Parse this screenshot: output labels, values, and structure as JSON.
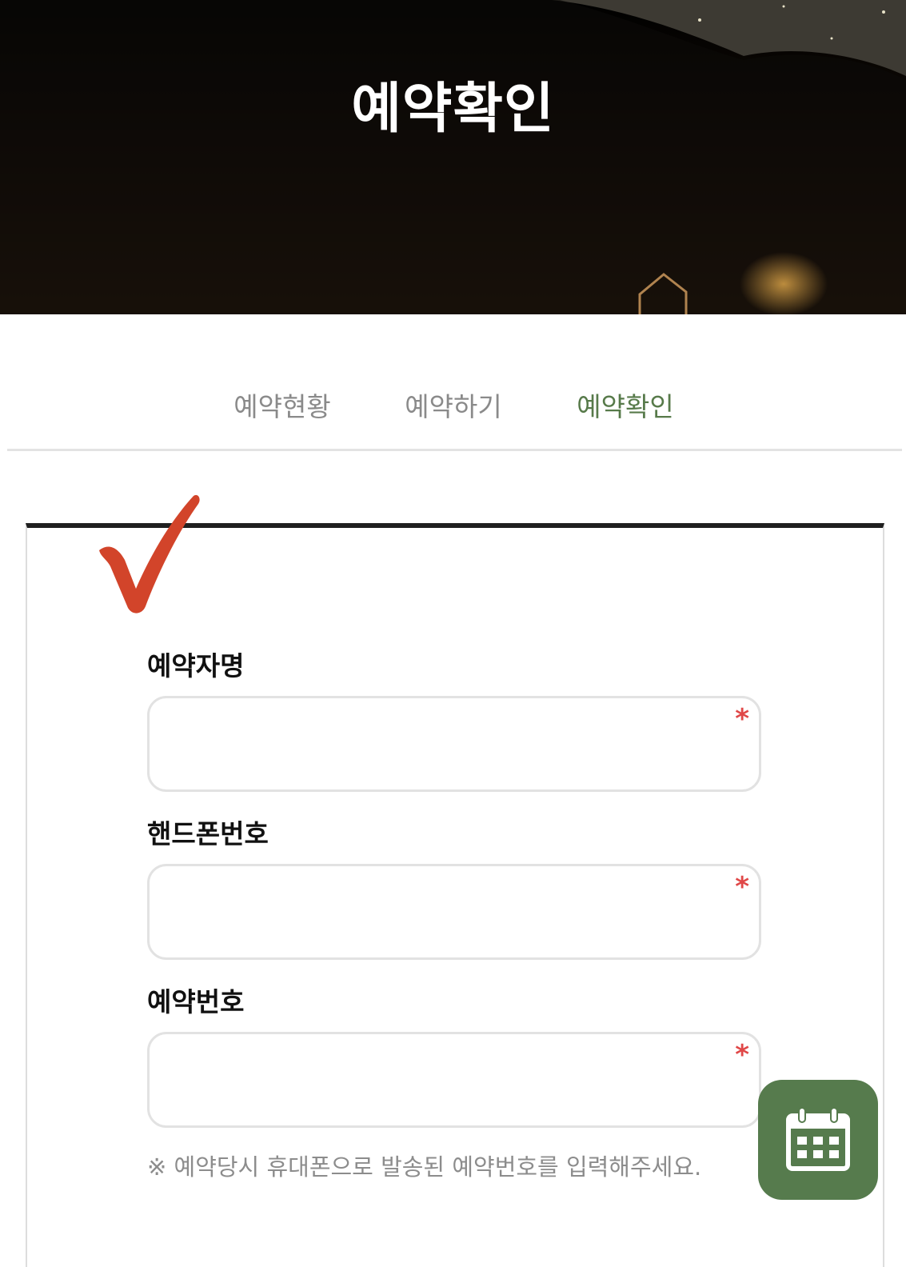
{
  "hero": {
    "title": "예약확인"
  },
  "tabs": [
    {
      "label": "예약현황",
      "active": false
    },
    {
      "label": "예약하기",
      "active": false
    },
    {
      "label": "예약확인",
      "active": true
    }
  ],
  "form": {
    "fields": [
      {
        "label": "예약자명",
        "value": "",
        "required_mark": "*"
      },
      {
        "label": "핸드폰번호",
        "value": "",
        "required_mark": "*"
      },
      {
        "label": "예약번호",
        "value": "",
        "required_mark": "*"
      }
    ],
    "hint": "※ 예약당시 휴대폰으로 발송된 예약번호를 입력해주세요."
  },
  "icons": {
    "checkmark": "checkmark-icon",
    "calendar": "calendar-icon"
  },
  "colors": {
    "accent_green": "#577a4a",
    "fab_green": "#567b4d",
    "required_red": "#e04848",
    "checkmark_red": "#d2442a"
  }
}
